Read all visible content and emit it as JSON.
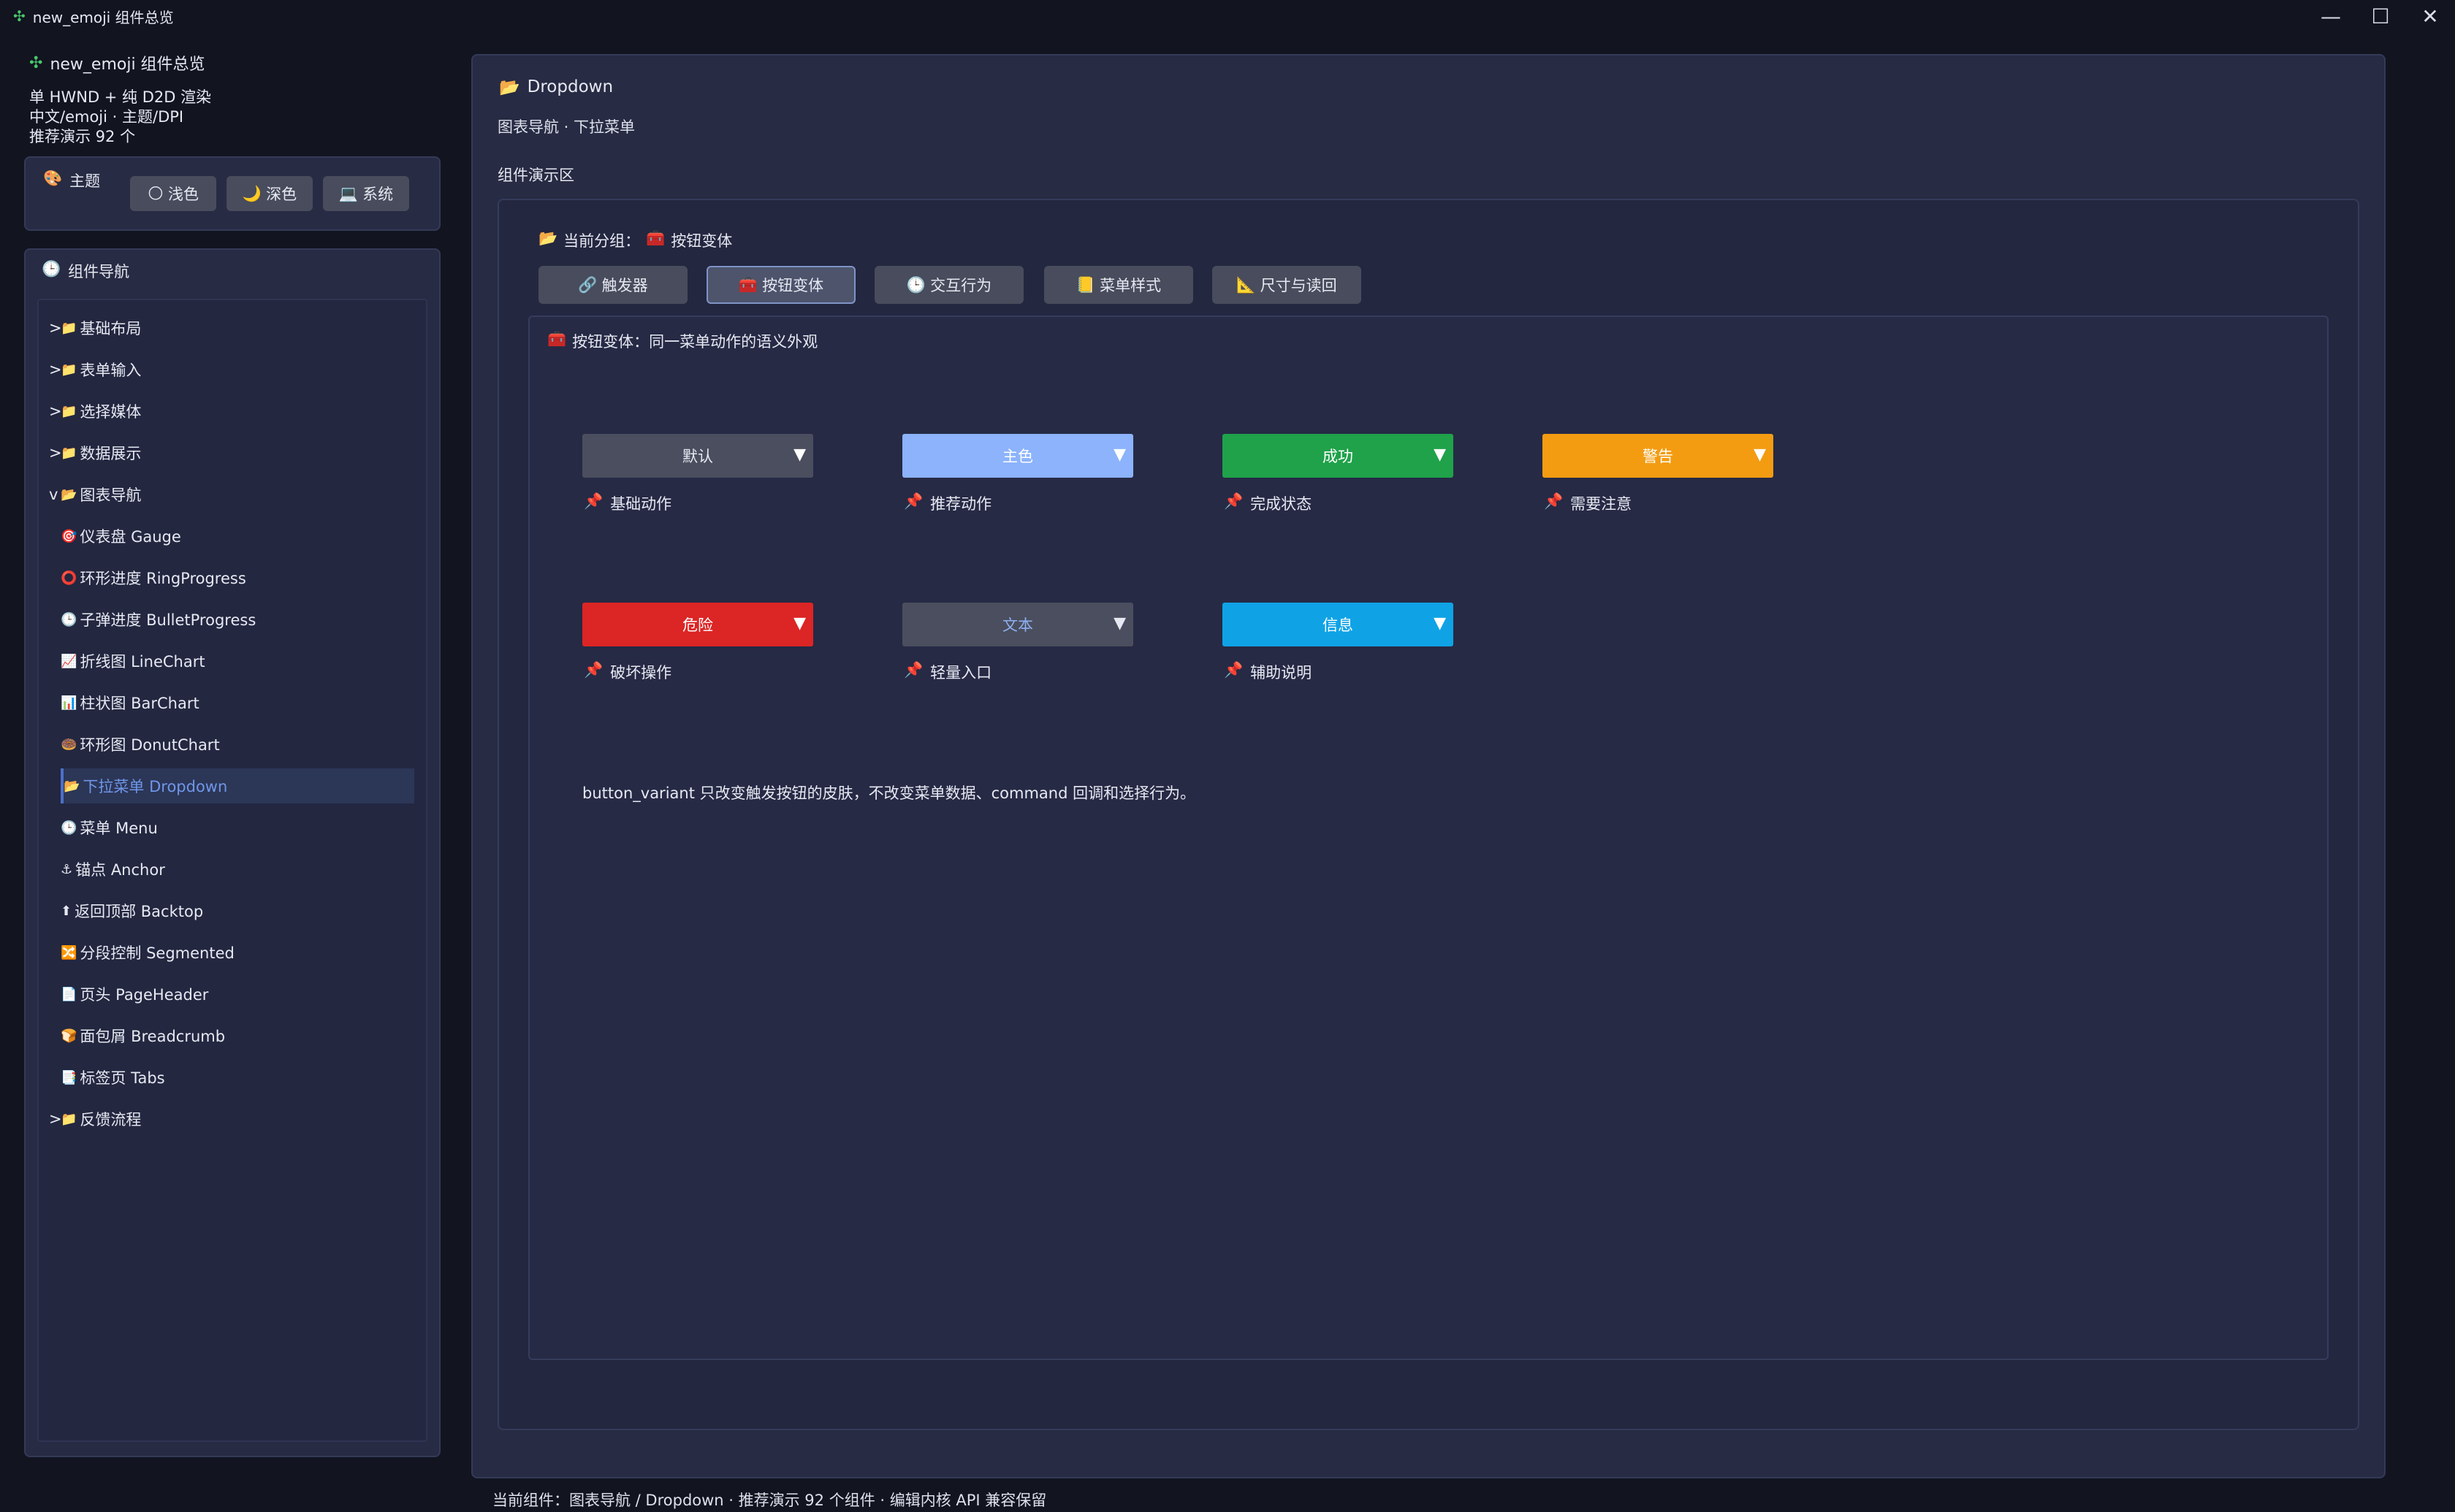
{
  "window": {
    "title": "new_emoji 组件总览",
    "controls": {
      "minimize": "—",
      "maximize": "☐",
      "close": "✕"
    }
  },
  "sidebar": {
    "app_title": "new_emoji 组件总览",
    "info_lines": [
      "单 HWND + 纯 D2D 渲染",
      "中文/emoji · 主题/DPI",
      "推荐演示 92 个"
    ],
    "theme": {
      "label": "主题",
      "buttons": [
        {
          "icon": "🌕",
          "label": "浅色"
        },
        {
          "icon": "🌙",
          "label": "深色"
        },
        {
          "icon": "💻",
          "label": "系统"
        }
      ]
    },
    "nav": {
      "title": "组件导航",
      "items": [
        {
          "prefix": ">",
          "icon": "📁",
          "label": "基础布局",
          "child": false
        },
        {
          "prefix": ">",
          "icon": "📁",
          "label": "表单输入",
          "child": false
        },
        {
          "prefix": ">",
          "icon": "📁",
          "label": "选择媒体",
          "child": false
        },
        {
          "prefix": ">",
          "icon": "📁",
          "label": "数据展示",
          "child": false
        },
        {
          "prefix": "v",
          "icon": "📂",
          "label": "图表导航",
          "child": false
        },
        {
          "prefix": "",
          "icon": "🎯",
          "label": "仪表盘 Gauge",
          "child": true
        },
        {
          "prefix": "",
          "icon": "⭕",
          "label": "环形进度 RingProgress",
          "child": true
        },
        {
          "prefix": "",
          "icon": "🕒",
          "label": "子弹进度 BulletProgress",
          "child": true
        },
        {
          "prefix": "",
          "icon": "📈",
          "label": "折线图 LineChart",
          "child": true
        },
        {
          "prefix": "",
          "icon": "📊",
          "label": "柱状图 BarChart",
          "child": true
        },
        {
          "prefix": "",
          "icon": "🍩",
          "label": "环形图 DonutChart",
          "child": true
        },
        {
          "prefix": "",
          "icon": "📂",
          "label": "下拉菜单 Dropdown",
          "child": true,
          "active": true
        },
        {
          "prefix": "",
          "icon": "🕒",
          "label": "菜单 Menu",
          "child": true
        },
        {
          "prefix": "",
          "icon": "⚓",
          "label": "锚点 Anchor",
          "child": true
        },
        {
          "prefix": "",
          "icon": "⬆",
          "label": "返回顶部 Backtop",
          "child": true
        },
        {
          "prefix": "",
          "icon": "🔀",
          "label": "分段控制 Segmented",
          "child": true
        },
        {
          "prefix": "",
          "icon": "📄",
          "label": "页头 PageHeader",
          "child": true
        },
        {
          "prefix": "",
          "icon": "🍞",
          "label": "面包屑 Breadcrumb",
          "child": true
        },
        {
          "prefix": "",
          "icon": "📑",
          "label": "标签页 Tabs",
          "child": true
        },
        {
          "prefix": ">",
          "icon": "📁",
          "label": "反馈流程",
          "child": false
        }
      ]
    }
  },
  "main": {
    "title": "Dropdown",
    "subtitle": "图表导航 · 下拉菜单",
    "demo_label": "组件演示区",
    "group_label": "当前分组：",
    "group_icon": "🧰",
    "group_value": "按钮变体",
    "tabs": [
      {
        "icon": "🔗",
        "label": "触发器"
      },
      {
        "icon": "🧰",
        "label": "按钮变体",
        "selected": true
      },
      {
        "icon": "🕒",
        "label": "交互行为"
      },
      {
        "icon": "📒",
        "label": "菜单样式"
      },
      {
        "icon": "📐",
        "label": "尺寸与读回"
      }
    ],
    "variant_title": "按钮变体：同一菜单动作的语义外观",
    "variants": [
      {
        "label": "默认",
        "caption": "基础动作",
        "bg": "#4a4e5e",
        "fg": "#e6e9f2"
      },
      {
        "label": "主色",
        "caption": "推荐动作",
        "bg": "#8cb3fb",
        "fg": "#ffffff"
      },
      {
        "label": "成功",
        "caption": "完成状态",
        "bg": "#1fa24a",
        "fg": "#ffffff"
      },
      {
        "label": "警告",
        "caption": "需要注意",
        "bg": "#f39c12",
        "fg": "#ffffff"
      },
      {
        "label": "危险",
        "caption": "破坏操作",
        "bg": "#dc2525",
        "fg": "#ffffff"
      },
      {
        "label": "文本",
        "caption": "轻量入口",
        "bg": "#4a4e5e",
        "fg": "#8fb0f2"
      },
      {
        "label": "信息",
        "caption": "辅助说明",
        "bg": "#0fa3e6",
        "fg": "#ffffff"
      }
    ],
    "dropdown_arrow": "▼",
    "note": "button_variant 只改变触发按钮的皮肤，不改变菜单数据、command 回调和选择行为。"
  },
  "status_bar": "当前组件：图表导航 / Dropdown · 推荐演示 92 个组件 · 编辑内核 API 兼容保留",
  "colors": {
    "window_bg": "#121420",
    "panel_bg": "#272b43",
    "accent": "#4c70c9"
  }
}
